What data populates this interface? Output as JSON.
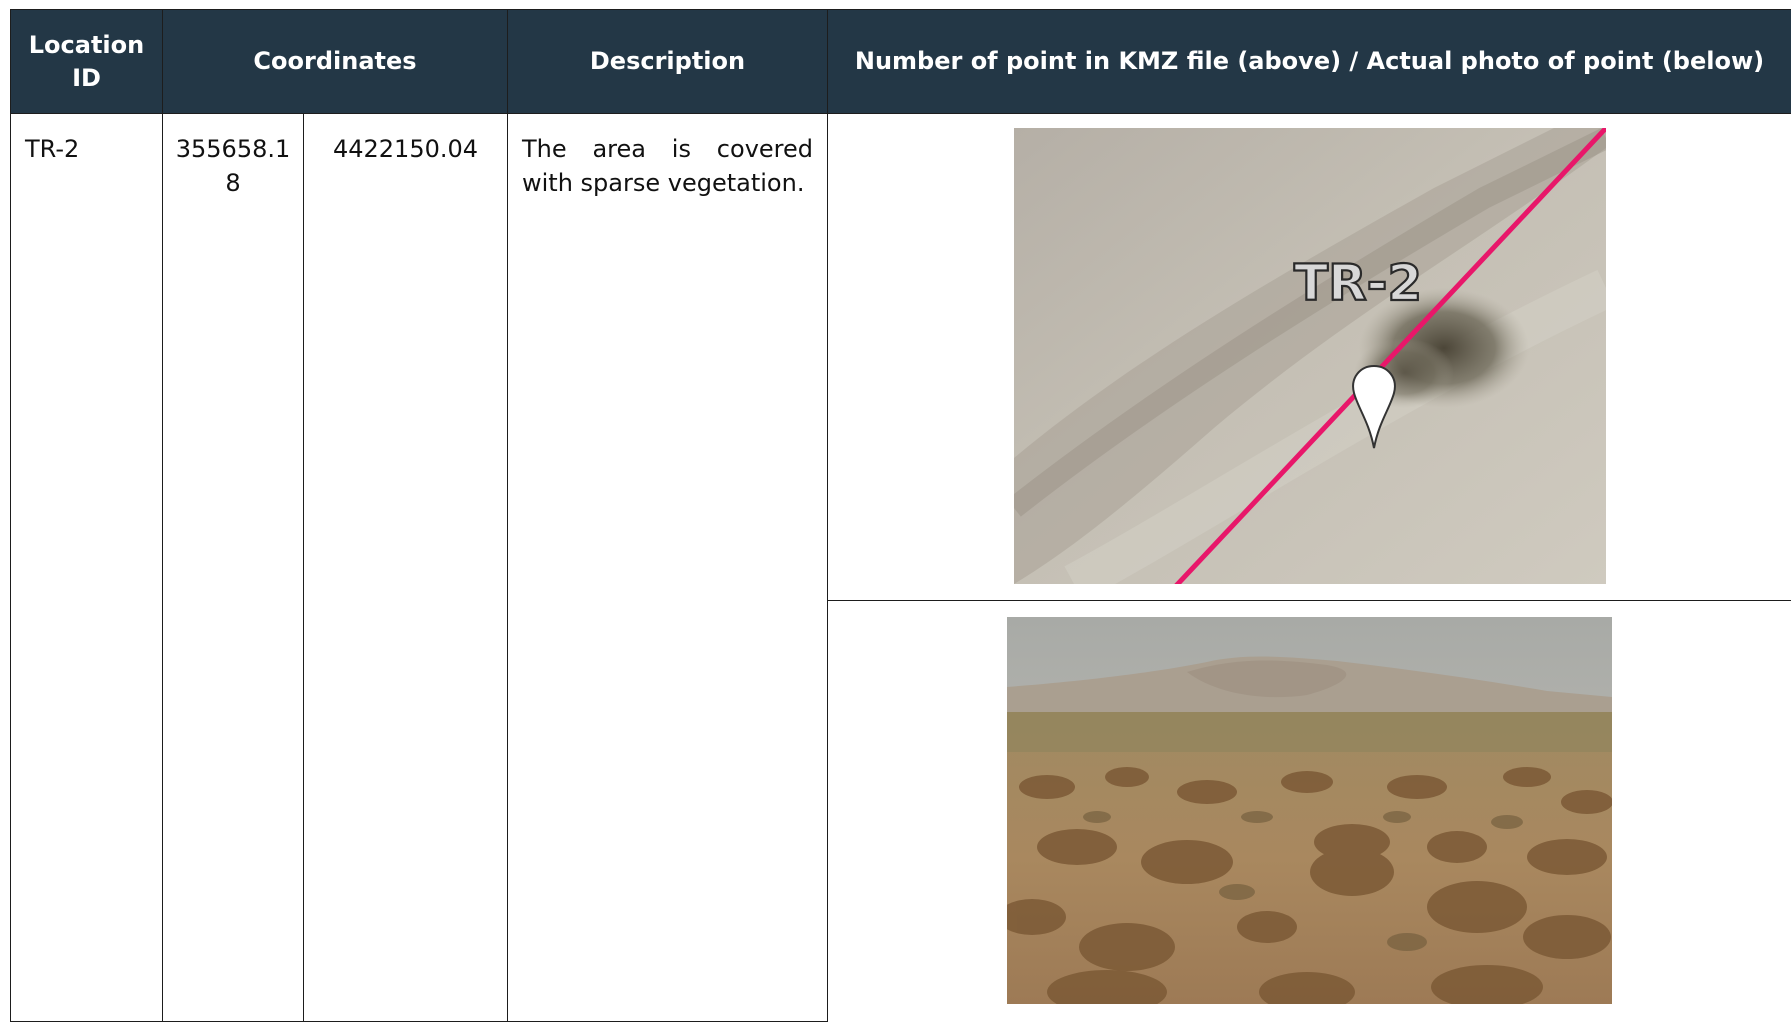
{
  "table": {
    "headers": {
      "location_id": "Location ID",
      "coordinates": "Coordinates",
      "description": "Description",
      "media": "Number of point in KMZ file (above) / Actual photo of point (below)"
    },
    "rows": [
      {
        "location_id": "TR-2",
        "easting": "355658.18",
        "northing": "4422150.04",
        "description": "The area is covered with sparse vegetation.",
        "kmz_point_label": "TR-2"
      }
    ]
  },
  "colors": {
    "header_bg": "#233746",
    "header_text": "#ffffff",
    "kmz_line": "#e8176a",
    "grid": "#1d1d1d"
  },
  "icons": {
    "map_pin": "placemark-pin-icon"
  }
}
